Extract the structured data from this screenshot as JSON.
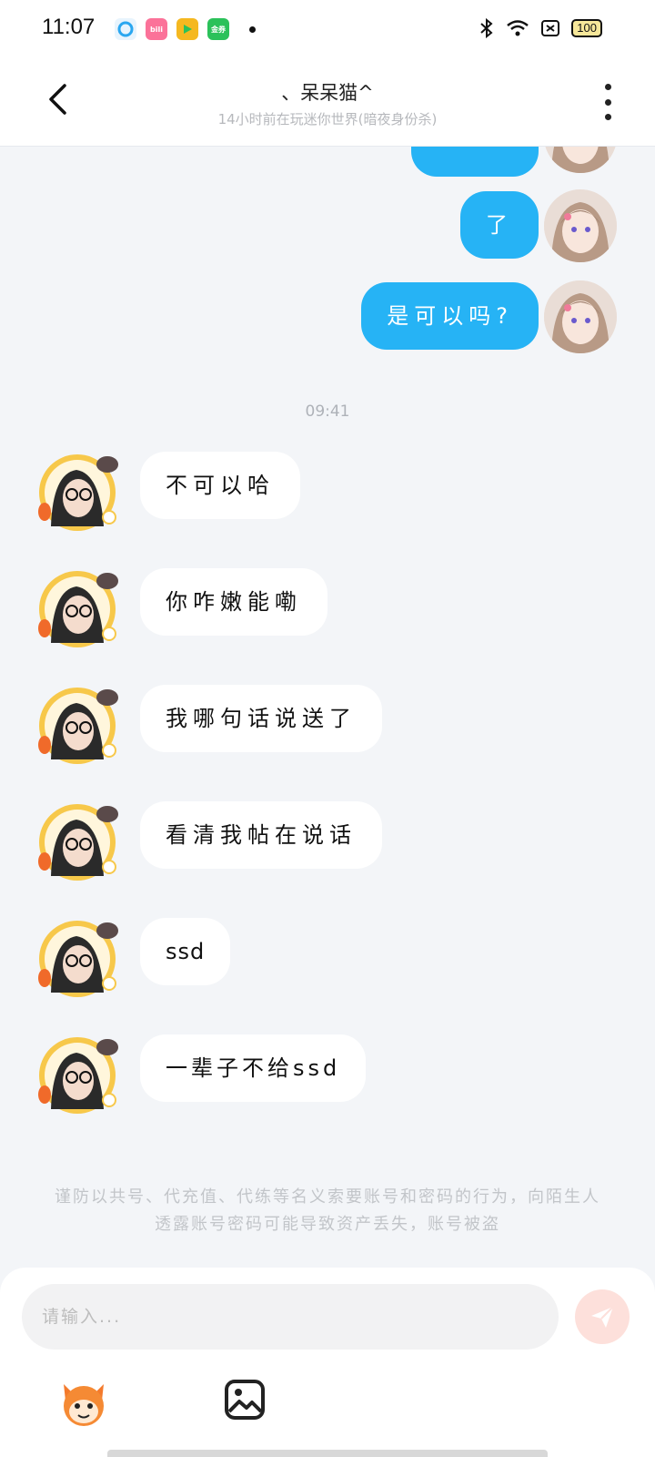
{
  "status_bar": {
    "time": "11:07",
    "app_icons": [
      {
        "name": "browser-app-icon",
        "label": "",
        "color": "#2aa7f0"
      },
      {
        "name": "bilibili-app-icon",
        "label": "bili",
        "color": "#fb7299"
      },
      {
        "name": "game-app-icon",
        "label": "",
        "color": "#f5b820"
      },
      {
        "name": "green-app-icon",
        "label": "金券",
        "color": "#2bc15a"
      }
    ],
    "battery": "100"
  },
  "header": {
    "title": "、呆呆猫^",
    "subtitle": "14小时前在玩迷你世界(暗夜身份杀)"
  },
  "messages": {
    "outgoing": [
      {
        "text": ""
      },
      {
        "text": "了"
      },
      {
        "text": "是可以吗?"
      }
    ],
    "timestamp": "09:41",
    "incoming": [
      {
        "text": "不可以哈"
      },
      {
        "text": "你咋嫩能嘞"
      },
      {
        "text": "我哪句话说送了"
      },
      {
        "text": "看清我帖在说话"
      },
      {
        "text": "ssd"
      },
      {
        "text": "一辈子不给ssd"
      }
    ]
  },
  "notice": "谨防以共号、代充值、代练等名义索要账号和密码的行为，向陌生人透露账号密码可能导致资产丢失，账号被盗",
  "input": {
    "placeholder": "请输入..."
  },
  "colors": {
    "outgoing_bubble": "#26b3f5",
    "send_button": "#fde0db",
    "send_arrow": "#ffffff"
  }
}
